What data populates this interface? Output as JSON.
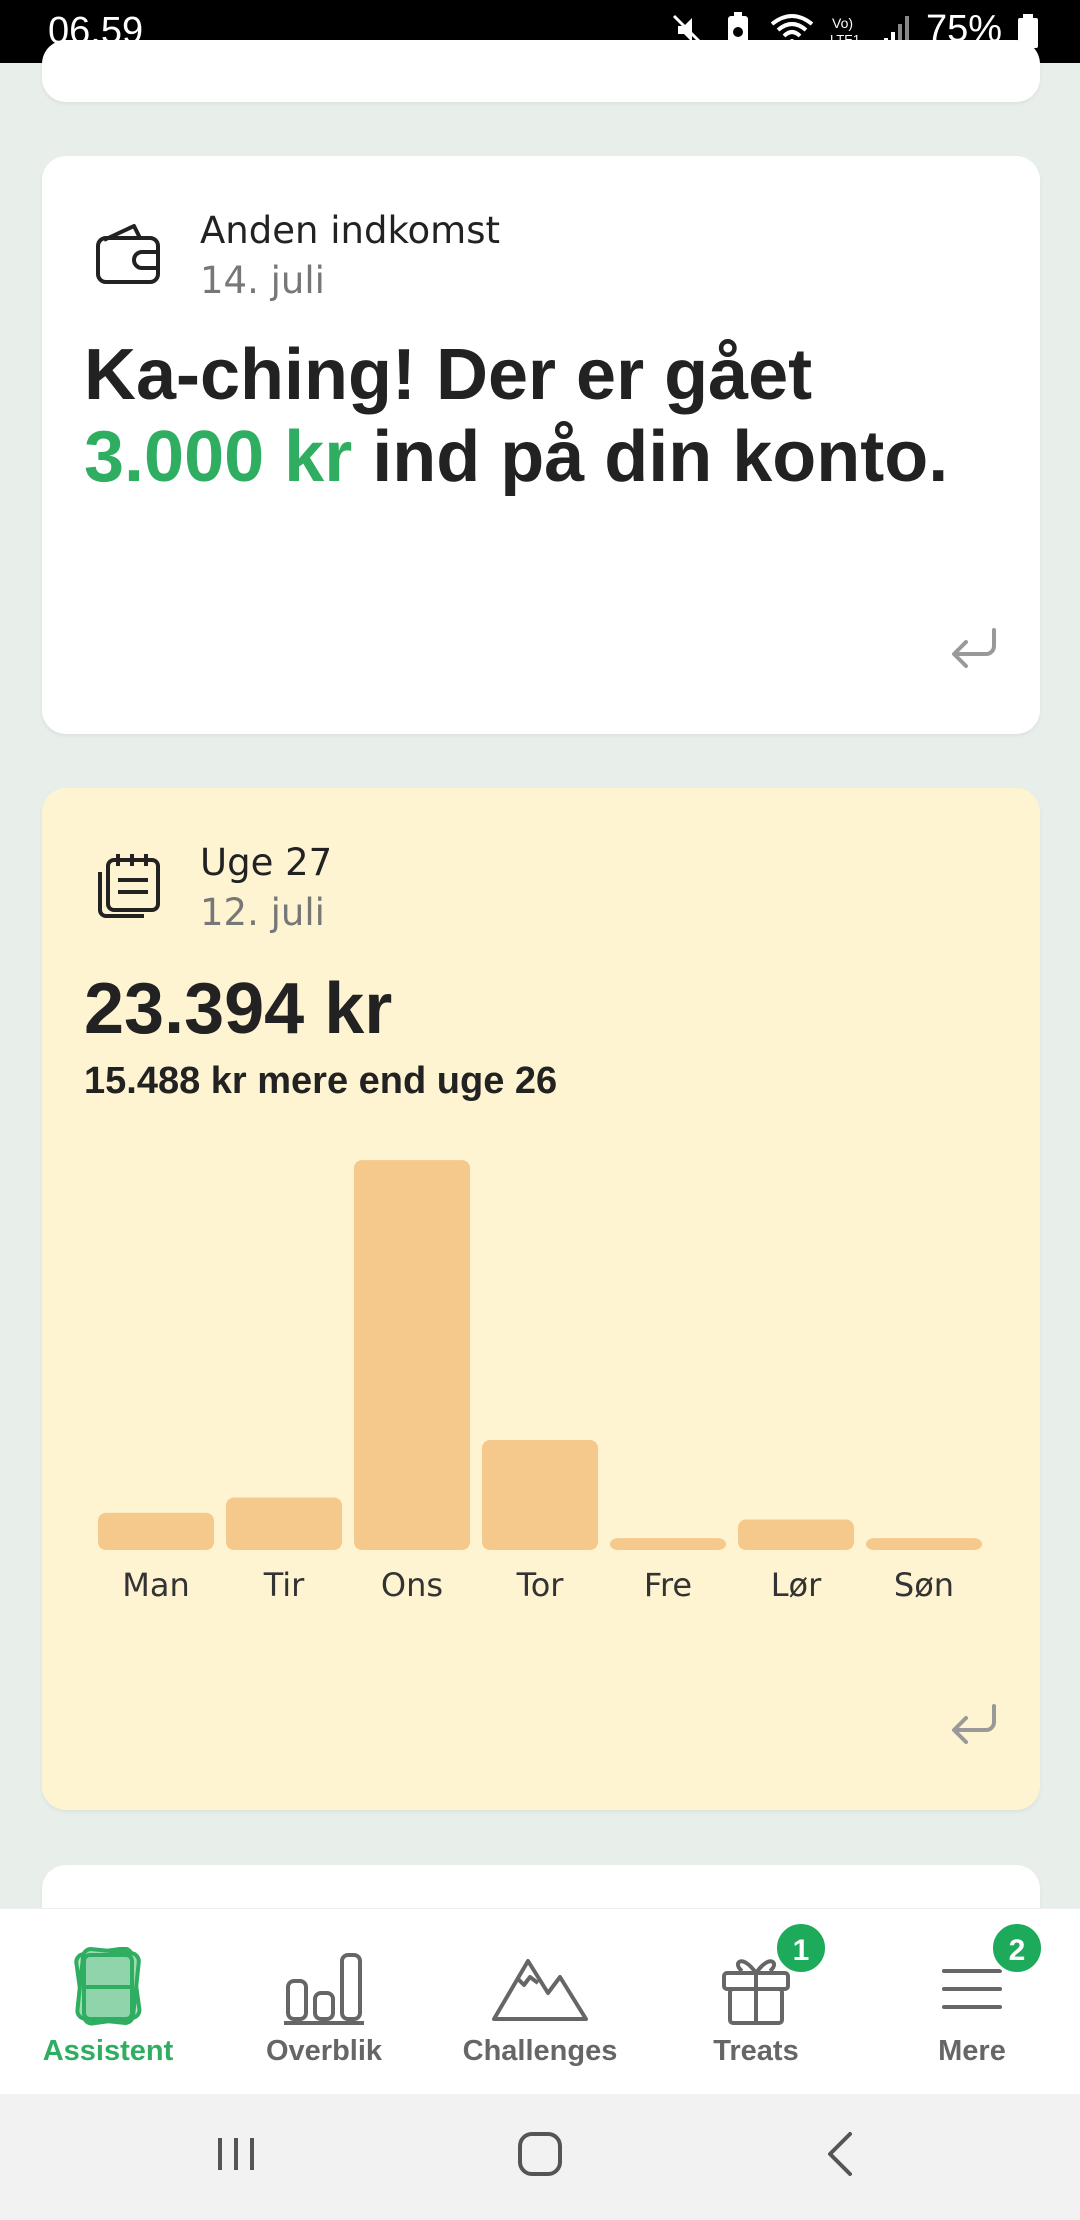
{
  "status_bar": {
    "time": "06.59",
    "battery": "75%",
    "icons": [
      "mute-icon",
      "battery-saver-icon",
      "wifi-icon",
      "volte-icon",
      "signal-icon",
      "battery-icon"
    ]
  },
  "colors": {
    "accent_green": "#2fae62",
    "week_card_bg": "#fef4d2",
    "bar_color": "#f5c98c",
    "badge_green": "#1daa5b"
  },
  "income_card": {
    "icon": "wallet-icon",
    "title": "Anden indkomst",
    "date": "14. juli",
    "headline_pre": "Ka-ching! Der er gået",
    "headline_amount": "3.000 kr",
    "headline_post": "ind på din konto."
  },
  "week_card": {
    "icon": "notes-icon",
    "title": "Uge 27",
    "date": "12. juli",
    "amount": "23.394 kr",
    "compare": "15.488 kr mere end uge 26"
  },
  "chart_data": {
    "type": "bar",
    "categories": [
      "Man",
      "Tir",
      "Ons",
      "Tor",
      "Fre",
      "Lør",
      "Søn"
    ],
    "values": [
      440,
      620,
      4610,
      1300,
      140,
      360,
      140
    ],
    "title": "",
    "xlabel": "",
    "ylabel": "",
    "ylim": [
      0,
      4800
    ],
    "grid": false
  },
  "bottom_nav": {
    "items": [
      {
        "label": "Assistent",
        "icon": "assistant-cards-icon",
        "active": true,
        "badge": ""
      },
      {
        "label": "Overblik",
        "icon": "bar-chart-icon",
        "active": false,
        "badge": ""
      },
      {
        "label": "Challenges",
        "icon": "mountain-icon",
        "active": false,
        "badge": ""
      },
      {
        "label": "Treats",
        "icon": "gift-icon",
        "active": false,
        "badge": "1"
      },
      {
        "label": "Mere",
        "icon": "menu-icon",
        "active": false,
        "badge": "2"
      }
    ]
  },
  "system_nav": {
    "buttons": [
      "recents-icon",
      "home-icon",
      "back-icon"
    ]
  }
}
